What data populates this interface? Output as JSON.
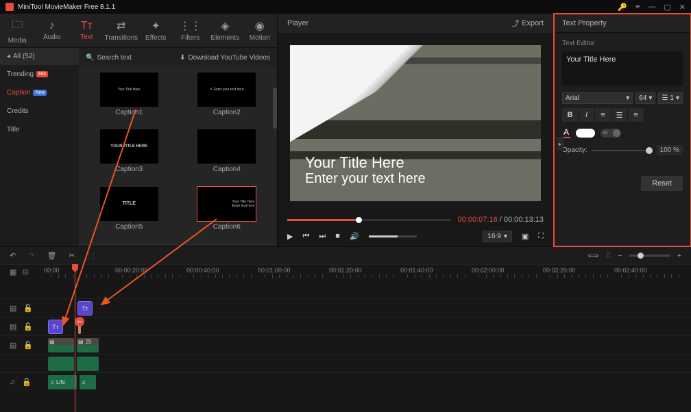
{
  "app": {
    "title": "MiniTool MovieMaker Free 8.1.1"
  },
  "toolbar": {
    "items": [
      {
        "icon": "🗀",
        "label": "Media"
      },
      {
        "icon": "♪",
        "label": "Audio"
      },
      {
        "icon": "Tᴛ",
        "label": "Text"
      },
      {
        "icon": "⇄",
        "label": "Transitions"
      },
      {
        "icon": "✦",
        "label": "Effects"
      },
      {
        "icon": "⋮⋮",
        "label": "Filters"
      },
      {
        "icon": "◈",
        "label": "Elements"
      },
      {
        "icon": "◉",
        "label": "Motion"
      }
    ]
  },
  "sidebar": {
    "all": "All (52)",
    "items": [
      {
        "label": "Trending",
        "badge": "Hot"
      },
      {
        "label": "Caption",
        "badge": "New"
      },
      {
        "label": "Credits"
      },
      {
        "label": "Title"
      }
    ]
  },
  "libHeader": {
    "search": "Search text",
    "download": "Download YouTube Videos"
  },
  "captions": [
    "Caption1",
    "Caption2",
    "Caption3",
    "Caption4",
    "Caption5",
    "Caption6"
  ],
  "captionPreview": [
    "Your Title Here",
    "✎ Enter your text here",
    "",
    "",
    "YOUR TITLE HERE",
    "",
    "",
    "",
    "TITLE",
    "Your Title Here\nEnter text here"
  ],
  "player": {
    "title": "Player",
    "export": "Export",
    "curTime": "00:00:07:16",
    "totalTime": "00:00:13:13",
    "ratio": "16:9",
    "overlayTitle": "Your Title Here",
    "overlaySub": "Enter your text here"
  },
  "textProp": {
    "title": "Text Property",
    "editor": "Text Editor",
    "value": "Your Title Here",
    "font": "Arial",
    "size": "64",
    "spacing": "1",
    "opacityLabel": "Opacity:",
    "opacityVal": "100 %",
    "reset": "Reset",
    "ab": "ab"
  },
  "ruler": [
    "00:00",
    "00:00:20:00",
    "00:00:40:00",
    "00:01:00:00",
    "00:01:20:00",
    "00:01:40:00",
    "00:02:00:00",
    "00:02:20:00",
    "00:02:40:00"
  ],
  "clips": {
    "vidDur": "25",
    "audioLabel": "Life"
  }
}
